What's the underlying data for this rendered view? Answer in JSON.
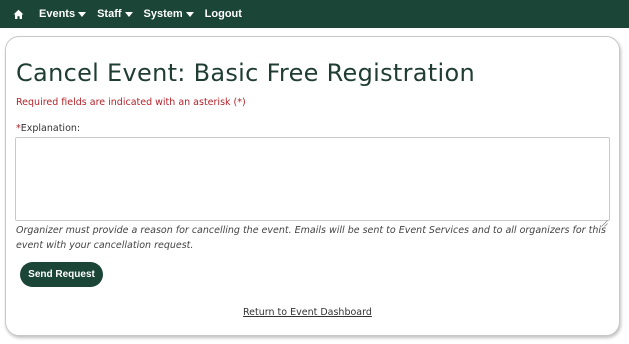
{
  "nav": {
    "home_icon": "home-icon",
    "items": [
      {
        "label": "Events",
        "has_dropdown": true
      },
      {
        "label": "Staff",
        "has_dropdown": true
      },
      {
        "label": "System",
        "has_dropdown": true
      },
      {
        "label": "Logout",
        "has_dropdown": false
      }
    ],
    "background": "#1b4536"
  },
  "page": {
    "title": "Cancel Event: Basic Free Registration",
    "required_note": "Required fields are indicated with an asterisk (*)",
    "field_label_asterisk": "*",
    "field_label": "Explanation:",
    "explanation_value": "",
    "help_text": "Organizer must provide a reason for cancelling the event. Emails will be sent to Event Services and to all organizers for this event with your cancellation request.",
    "send_button_label": "Send Request",
    "return_link": "Return to Event Dashboard"
  },
  "colors": {
    "brand_green": "#1b4536",
    "title_green": "#1f3d33",
    "required_red": "#b2232a"
  }
}
